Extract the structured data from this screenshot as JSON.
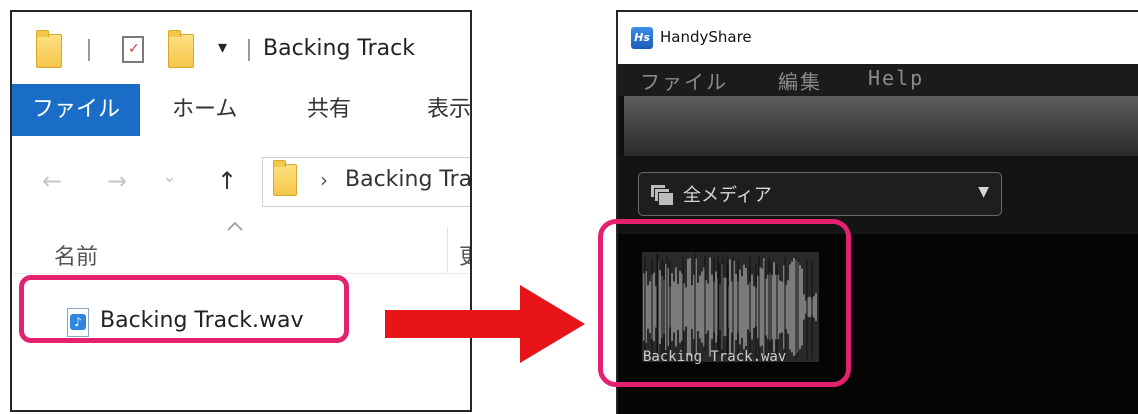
{
  "explorer": {
    "title": "Backing Track",
    "quick_access": {
      "dropdown_glyph": "▾",
      "check_glyph": "✓"
    },
    "ribbon_tabs": [
      {
        "label": "ファイル",
        "active": true
      },
      {
        "label": "ホーム",
        "active": false
      },
      {
        "label": "共有",
        "active": false
      },
      {
        "label": "表示",
        "active": false
      }
    ],
    "nav": {
      "back": "←",
      "forward": "→",
      "recent": "⌄",
      "up": "↑"
    },
    "address": {
      "chevron": "›",
      "path": "Backing Track"
    },
    "columns": {
      "name": "名前",
      "date": "更新日時"
    },
    "file": {
      "name": "Backing Track.wav",
      "icon": "audio-file-icon"
    }
  },
  "handyshare": {
    "app_title": "HandyShare",
    "logo_text": "Hs",
    "menu": [
      "ファイル",
      "編集",
      "Help"
    ],
    "media_filter": {
      "label": "全メディア",
      "caret": "▼",
      "icon": "media-stack-icon"
    },
    "media_items": [
      {
        "name": "Backing Track.wav"
      }
    ]
  },
  "colors": {
    "highlight": "#e3216e",
    "arrow": "#e8141a",
    "explorer_accent": "#1a6dc6",
    "folder": "#f4c64a",
    "hs_background": "#141414"
  }
}
